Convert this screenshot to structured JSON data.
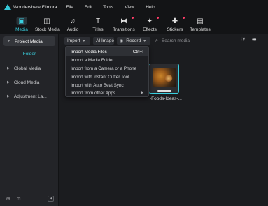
{
  "app": {
    "title": "Wondershare Filmora"
  },
  "menu": [
    "File",
    "Edit",
    "Tools",
    "View",
    "Help"
  ],
  "toolbar": {
    "tools": [
      {
        "label": "Media",
        "icon": "media-icon",
        "active": true
      },
      {
        "label": "Stock Media",
        "icon": "stock-media-icon"
      },
      {
        "label": "Audio",
        "icon": "audio-icon"
      },
      {
        "label": "Titles",
        "icon": "titles-icon"
      },
      {
        "label": "Transitions",
        "icon": "transitions-icon",
        "badge": true
      },
      {
        "label": "Effects",
        "icon": "effects-icon",
        "badge": true
      },
      {
        "label": "Stickers",
        "icon": "stickers-icon",
        "badge": true
      },
      {
        "label": "Templates",
        "icon": "templates-icon"
      }
    ]
  },
  "sidebar": {
    "project_media": "Project Media",
    "folder": "Folder",
    "items": [
      "Global Media",
      "Cloud Media",
      "Adjustment La..."
    ]
  },
  "actions": {
    "import_label": "Import",
    "ai_image_label": "AI Image",
    "record_label": "Record",
    "search_placeholder": "Search media"
  },
  "import_menu": {
    "items": [
      {
        "label": "Import Media Files",
        "shortcut": "Ctrl+I"
      },
      {
        "label": "Import a Media Folder"
      },
      {
        "label": "Import from a Camera or a Phone"
      },
      {
        "label": "Import with Instant Cutter Tool"
      },
      {
        "label": "Import with Auto Beat Sync"
      },
      {
        "label": "Import from other Apps",
        "submenu": true
      }
    ]
  },
  "media": {
    "clip_label": "-Foods-Ideas-..."
  },
  "colors": {
    "accent": "#3ad0e0",
    "badge": "#ff3d68",
    "background": "#1b1c1f",
    "sidebar": "#232428"
  }
}
